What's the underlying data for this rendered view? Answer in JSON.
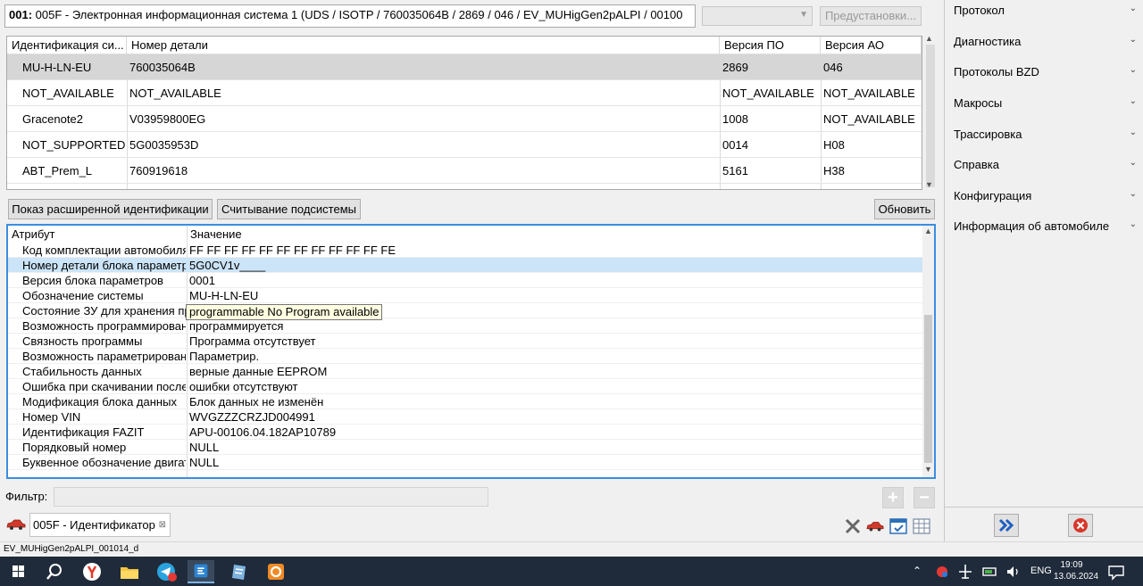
{
  "header": {
    "code": "001:",
    "title": " 005F - Электронная информационная система 1  (UDS / ISOTP / 760035064B / 2869 / 046 / EV_MUHigGen2pALPI / 00100",
    "preset_label": "Предустановки..."
  },
  "parts_table": {
    "columns": [
      "Идентификация си...",
      "Номер детали",
      "Версия ПО",
      "Версия АО"
    ],
    "rows": [
      {
        "id": "MU-H-LN-EU",
        "part": "760035064B",
        "sw": "2869",
        "hw": "046"
      },
      {
        "id": "NOT_AVAILABLE",
        "part": "NOT_AVAILABLE",
        "sw": "NOT_AVAILABLE",
        "hw": "NOT_AVAILABLE"
      },
      {
        "id": "Gracenote2",
        "part": "V03959800EG",
        "sw": "1008",
        "hw": "NOT_AVAILABLE"
      },
      {
        "id": "NOT_SUPPORTED",
        "part": "5G0035953D",
        "sw": "0014",
        "hw": "H08"
      },
      {
        "id": "ABT_Prem_L",
        "part": "760919618",
        "sw": "5161",
        "hw": "H38"
      }
    ]
  },
  "buttons": {
    "ext_ident": "Показ расширенной идентификации",
    "subsystems": "Считывание подсистемы",
    "refresh": "Обновить"
  },
  "attr_table": {
    "col_attr": "Атрибут",
    "col_value": "Значение",
    "rows": [
      {
        "k": "Код комплектации автомобиля",
        "v": "FF FF FF FF FF FF FF FF FF FF FF FE"
      },
      {
        "k": "Номер детали блока параметров",
        "v": "5G0CV1v____"
      },
      {
        "k": "Версия блока параметров",
        "v": "0001"
      },
      {
        "k": "Обозначение системы",
        "v": "MU-H-LN-EU"
      },
      {
        "k": "Состояние ЗУ для хранения программы",
        "v": ""
      },
      {
        "k": "Возможность программирования",
        "v": "программируется"
      },
      {
        "k": "Связность программы",
        "v": "Программа отсутствует"
      },
      {
        "k": "Возможность параметрирования",
        "v": "Параметрир."
      },
      {
        "k": "Стабильность данных",
        "v": "верные данные EEPROM"
      },
      {
        "k": "Ошибка при скачивании после",
        "v": "ошибки отсутствуют"
      },
      {
        "k": "Модификация блока данных",
        "v": "Блок данных не изменён"
      },
      {
        "k": "Номер VIN",
        "v": "WVGZZZCRZJD004991"
      },
      {
        "k": "Идентификация FAZIT",
        "v": "APU-00106.04.182AP10789"
      },
      {
        "k": "Порядковый номер",
        "v": "NULL"
      },
      {
        "k": "Буквенное обозначение двигателя",
        "v": "NULL"
      }
    ],
    "tooltip": "programmable No Program available"
  },
  "filter": {
    "label": "Фильтр:",
    "value": ""
  },
  "tab": {
    "label": "005F - Идентификатор",
    "close": "⊠"
  },
  "status_text": "EV_MUHigGen2pALPI_001014_d",
  "right_panel": {
    "items": [
      "Протокол",
      "Диагностика",
      "Протоколы BZD",
      "Макросы",
      "Трассировка",
      "Справка",
      "Конфигурация",
      "Информация об автомобиле"
    ]
  },
  "taskbar": {
    "lang": "ENG",
    "time": "19:09",
    "date": "13.06.2024"
  },
  "colors": {
    "selection_gray": "#d6d6d6",
    "selection_blue": "#cce4f7",
    "focus_border": "#3b8ee0",
    "taskbar": "#1f2b3a"
  }
}
